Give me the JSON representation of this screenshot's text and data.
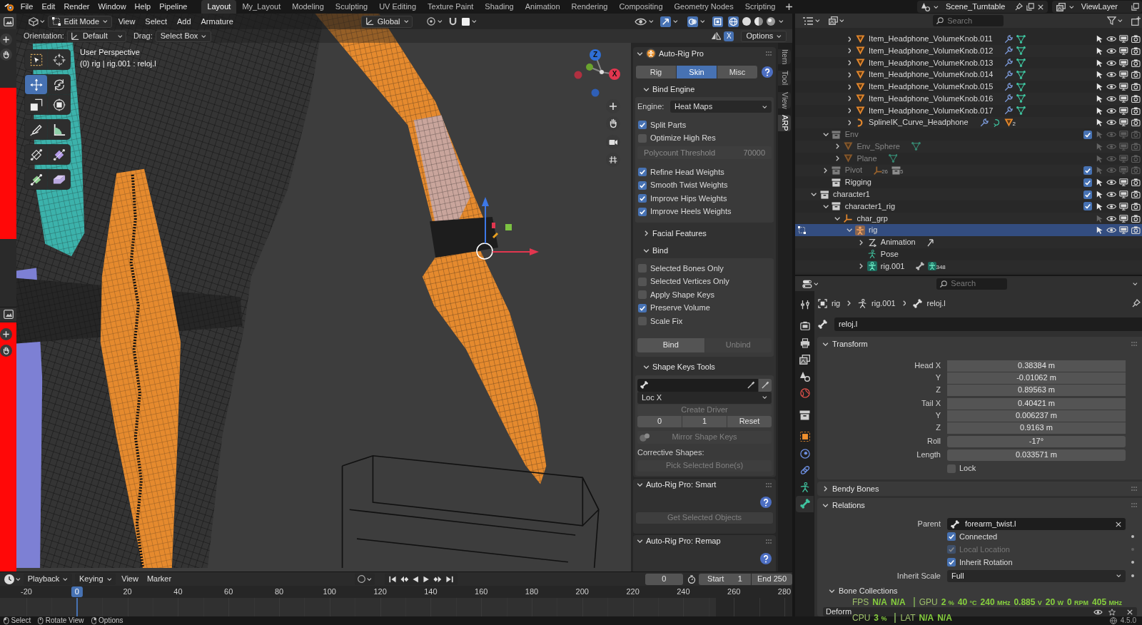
{
  "top_bar": {
    "menus": [
      "File",
      "Edit",
      "Render",
      "Window",
      "Help",
      "Pipeline"
    ],
    "workspaces": [
      {
        "label": "Layout",
        "selected": true
      },
      {
        "label": "My_Layout",
        "selected": false
      },
      {
        "label": "Modeling",
        "selected": false
      },
      {
        "label": "Sculpting",
        "selected": false
      },
      {
        "label": "UV Editing",
        "selected": false
      },
      {
        "label": "Texture Paint",
        "selected": false
      },
      {
        "label": "Shading",
        "selected": false
      },
      {
        "label": "Animation",
        "selected": false
      },
      {
        "label": "Rendering",
        "selected": false
      },
      {
        "label": "Compositing",
        "selected": false
      },
      {
        "label": "Geometry Nodes",
        "selected": false
      },
      {
        "label": "Scripting",
        "selected": false
      }
    ],
    "scene": "Scene_Turntable",
    "view_layer": "ViewLayer"
  },
  "viewport": {
    "header": {
      "mode": "Edit Mode",
      "menus": [
        "View",
        "Select",
        "Add",
        "Armature"
      ],
      "orientation": "Global"
    },
    "tool_settings": {
      "orientation_label": "Orientation:",
      "orientation": "Default",
      "drag_label": "Drag:",
      "drag": "Select Box",
      "mirror": {
        "label": "X",
        "on": true
      },
      "options": "Options"
    },
    "overlay_text": [
      "User Perspective",
      "(0) rig | rig.001 : reloj.l"
    ],
    "toolbar": [
      [
        {
          "kind": "select_box",
          "selected": false
        },
        {
          "kind": "cursor",
          "selected": false
        }
      ],
      [
        {
          "kind": "move",
          "selected": true
        },
        {
          "kind": "rotate",
          "selected": false
        },
        {
          "kind": "scale",
          "selected": false
        },
        {
          "kind": "transform",
          "selected": false
        }
      ],
      [
        {
          "kind": "annotate",
          "selected": false
        },
        {
          "kind": "measure",
          "selected": false
        }
      ],
      [
        {
          "kind": "roll",
          "selected": false
        },
        {
          "kind": "bone_size",
          "selected": false
        }
      ],
      [
        {
          "kind": "extrude",
          "selected": false
        },
        {
          "kind": "shear",
          "selected": false
        }
      ]
    ],
    "gizmo_axes": [
      {
        "label": "Z",
        "color": "#2f6fd6"
      },
      {
        "label": "X",
        "color": "#e2364f"
      }
    ],
    "sidebar_panels": [
      {
        "title": "Auto-Rig Pro",
        "expanded": true,
        "rows": [
          {
            "kind": "tabs",
            "items": [
              {
                "label": "Rig",
                "selected": false
              },
              {
                "label": "Skin",
                "selected": true
              },
              {
                "label": "Misc",
                "selected": false
              }
            ]
          },
          {
            "kind": "subpanel",
            "label": "Bind Engine",
            "expanded": true,
            "rows": [
              {
                "kind": "dropdown",
                "label": "Engine:",
                "value": "Heat Maps"
              },
              {
                "kind": "checkbox",
                "label": "Split Parts",
                "checked": true
              },
              {
                "kind": "checkbox",
                "label": "Optimize High Res",
                "checked": false
              },
              {
                "kind": "number",
                "label": "Polycount Threshold",
                "value": "70000",
                "disabled": true
              },
              {
                "kind": "checkbox",
                "label": "Refine Head Weights",
                "checked": true
              },
              {
                "kind": "checkbox",
                "label": "Smooth Twist Weights",
                "checked": true
              },
              {
                "kind": "checkbox",
                "label": "Improve Hips Weights",
                "checked": true
              },
              {
                "kind": "checkbox",
                "label": "Improve Heels Weights",
                "checked": true
              }
            ]
          },
          {
            "kind": "subpanel",
            "label": "Facial Features",
            "expanded": false
          },
          {
            "kind": "subpanel",
            "label": "Bind",
            "expanded": true,
            "rows": [
              {
                "kind": "checkbox",
                "label": "Selected Bones Only",
                "checked": false
              },
              {
                "kind": "checkbox",
                "label": "Selected Vertices Only",
                "checked": false
              },
              {
                "kind": "checkbox",
                "label": "Apply Shape Keys",
                "checked": false
              },
              {
                "kind": "checkbox",
                "label": "Preserve Volume",
                "checked": true
              },
              {
                "kind": "checkbox",
                "label": "Scale Fix",
                "checked": false
              },
              {
                "kind": "buttons",
                "items": [
                  {
                    "label": "Bind",
                    "disabled": false
                  },
                  {
                    "label": "Unbind",
                    "disabled": true
                  }
                ]
              }
            ]
          },
          {
            "kind": "subpanel",
            "label": "Shape Keys Tools",
            "expanded": true,
            "rows": [
              {
                "kind": "bone_field"
              },
              {
                "kind": "dropdown",
                "value": "Loc X"
              },
              {
                "kind": "buttons",
                "items": [
                  {
                    "label": "Create Driver",
                    "disabled": true
                  }
                ]
              },
              {
                "kind": "buttons",
                "items": [
                  {
                    "label": "0",
                    "disabled": false
                  },
                  {
                    "label": "1",
                    "disabled": false
                  },
                  {
                    "label": "Reset",
                    "disabled": false
                  }
                ]
              },
              {
                "kind": "icon_button",
                "label": "Mirror Shape Keys",
                "disabled": true
              },
              {
                "kind": "label",
                "label": "Corrective Shapes:"
              },
              {
                "kind": "buttons",
                "items": [
                  {
                    "label": "Pick Selected Bone(s)",
                    "disabled": true
                  }
                ]
              }
            ]
          }
        ]
      },
      {
        "title": "Auto-Rig Pro: Smart",
        "expanded": true,
        "rows": [
          {
            "kind": "help"
          },
          {
            "kind": "buttons",
            "items": [
              {
                "label": "Get Selected Objects",
                "disabled": true
              }
            ]
          }
        ]
      },
      {
        "title": "Auto-Rig Pro: Remap",
        "expanded": true,
        "rows": [
          {
            "kind": "help"
          }
        ]
      }
    ],
    "sidebar_tabs": [
      {
        "label": "Item",
        "selected": false
      },
      {
        "label": "Tool",
        "selected": false
      },
      {
        "label": "View",
        "selected": false
      },
      {
        "label": "ARP",
        "selected": true
      }
    ]
  },
  "timeline": {
    "menus": [
      {
        "label": "Playback",
        "kind": "dropdown"
      },
      {
        "label": "Keying",
        "kind": "dropdown"
      },
      {
        "label": "View",
        "kind": "menu"
      },
      {
        "label": "Marker",
        "kind": "menu"
      }
    ],
    "auto_keying": false,
    "current_frame": "0",
    "start_label": "Start",
    "start": "1",
    "end_label": "End",
    "end": "250",
    "ruler": [
      {
        "label": "-20",
        "current": false
      },
      {
        "label": "0",
        "current": true
      },
      {
        "label": "20",
        "current": false
      },
      {
        "label": "40",
        "current": false
      },
      {
        "label": "60",
        "current": false
      },
      {
        "label": "80",
        "current": false
      },
      {
        "label": "100",
        "current": false
      },
      {
        "label": "120",
        "current": false
      },
      {
        "label": "140",
        "current": false
      },
      {
        "label": "160",
        "current": false
      },
      {
        "label": "180",
        "current": false
      },
      {
        "label": "200",
        "current": false
      },
      {
        "label": "220",
        "current": false
      },
      {
        "label": "240",
        "current": false
      },
      {
        "label": "260",
        "current": false
      },
      {
        "label": "280",
        "current": false
      }
    ]
  },
  "outliner": {
    "search_placeholder": "Search",
    "tree": [
      {
        "children": [
          {
            "children": [
              {
                "children": [
                  {
                    "label": "Item_Headphone_VolumeKnob.011",
                    "kind": "mesh",
                    "expanded": false,
                    "selected": false,
                    "dimmed": false,
                    "selectable": true,
                    "extras": [
                      {
                        "kind": "modifier"
                      },
                      {
                        "kind": "mesh_data"
                      }
                    ]
                  },
                  {
                    "label": "Item_Headphone_VolumeKnob.012",
                    "kind": "mesh",
                    "expanded": false,
                    "selected": false,
                    "dimmed": false,
                    "selectable": true,
                    "extras": [
                      {
                        "kind": "modifier"
                      },
                      {
                        "kind": "mesh_data"
                      }
                    ]
                  },
                  {
                    "label": "Item_Headphone_VolumeKnob.013",
                    "kind": "mesh",
                    "expanded": false,
                    "selected": false,
                    "dimmed": false,
                    "selectable": true,
                    "extras": [
                      {
                        "kind": "modifier"
                      },
                      {
                        "kind": "mesh_data"
                      }
                    ]
                  },
                  {
                    "label": "Item_Headphone_VolumeKnob.014",
                    "kind": "mesh",
                    "expanded": false,
                    "selected": false,
                    "dimmed": false,
                    "selectable": true,
                    "extras": [
                      {
                        "kind": "modifier"
                      },
                      {
                        "kind": "mesh_data"
                      }
                    ]
                  },
                  {
                    "label": "Item_Headphone_VolumeKnob.015",
                    "kind": "mesh",
                    "expanded": false,
                    "selected": false,
                    "dimmed": false,
                    "selectable": true,
                    "extras": [
                      {
                        "kind": "modifier"
                      },
                      {
                        "kind": "mesh_data"
                      }
                    ]
                  },
                  {
                    "label": "Item_Headphone_VolumeKnob.016",
                    "kind": "mesh",
                    "expanded": false,
                    "selected": false,
                    "dimmed": false,
                    "selectable": true,
                    "extras": [
                      {
                        "kind": "modifier"
                      },
                      {
                        "kind": "mesh_data"
                      }
                    ]
                  },
                  {
                    "label": "Item_Headphone_VolumeKnob.017",
                    "kind": "mesh",
                    "expanded": false,
                    "selected": false,
                    "dimmed": false,
                    "selectable": true,
                    "extras": [
                      {
                        "kind": "modifier"
                      },
                      {
                        "kind": "mesh_data"
                      }
                    ]
                  },
                  {
                    "label": "SplineIK_Curve_Headphone",
                    "kind": "curve",
                    "expanded": false,
                    "selected": false,
                    "dimmed": false,
                    "selectable": true,
                    "extras": [
                      {
                        "kind": "modifier"
                      },
                      {
                        "kind": "curve_data"
                      },
                      {
                        "kind": "mesh",
                        "count": "2"
                      }
                    ]
                  }
                ]
              }
            ]
          },
          {
            "label": "Env",
            "kind": "collection",
            "expanded": true,
            "checked": true,
            "selected": false,
            "dimmed": true,
            "selectable": true,
            "children": [
              {
                "label": "Env_Sphere",
                "kind": "mesh",
                "expanded": false,
                "selected": false,
                "dimmed": true,
                "selectable": true,
                "extras": [
                  {
                    "kind": "mesh_data"
                  }
                ]
              },
              {
                "label": "Plane",
                "kind": "mesh",
                "expanded": false,
                "selected": false,
                "dimmed": true,
                "selectable": true,
                "extras": [
                  {
                    "kind": "mesh_data"
                  }
                ]
              }
            ]
          },
          {
            "label": "Pivot",
            "kind": "collection",
            "expanded": false,
            "checked": true,
            "selected": false,
            "dimmed": true,
            "selectable": true,
            "extras": [
              {
                "kind": "empty",
                "count": "26"
              },
              {
                "kind": "collection",
                "count": "5"
              }
            ]
          },
          {
            "label": "Rigging",
            "kind": "collection",
            "checked": true,
            "selected": false,
            "dimmed": false,
            "selectable": true
          }
        ]
      },
      {
        "label": "character1",
        "kind": "collection",
        "expanded": true,
        "checked": true,
        "selected": false,
        "dimmed": false,
        "selectable": true,
        "children": [
          {
            "label": "character1_rig",
            "kind": "collection",
            "expanded": true,
            "checked": true,
            "selected": false,
            "dimmed": false,
            "selectable": true,
            "children": [
              {
                "label": "char_grp",
                "kind": "empty",
                "expanded": true,
                "selected": false,
                "dimmed": false,
                "selectable": false,
                "children": [
                  {
                    "label": "rig",
                    "kind": "armature",
                    "expanded": true,
                    "selected": true,
                    "dimmed": false,
                    "selectable": true,
                    "children": [
                      {
                        "label": "Animation",
                        "kind": "action",
                        "expanded": false,
                        "selected": false,
                        "extras": [
                          {
                            "kind": "action"
                          }
                        ]
                      },
                      {
                        "label": "Pose",
                        "kind": "pose",
                        "selected": false
                      },
                      {
                        "label": "rig.001",
                        "kind": "armature_data",
                        "expanded": false,
                        "selected": false,
                        "extras": [
                          {
                            "kind": "bone_constraint"
                          },
                          {
                            "kind": "armature_data",
                            "count": "348"
                          }
                        ]
                      }
                    ]
                  }
                ]
              }
            ]
          }
        ]
      }
    ]
  },
  "properties": {
    "search_placeholder": "Search",
    "tabs": [
      {
        "kind": "tool",
        "selected": false
      },
      {
        "kind": "render",
        "selected": false
      },
      {
        "kind": "output",
        "selected": false
      },
      {
        "kind": "view_layer",
        "selected": false
      },
      {
        "kind": "scene",
        "selected": false
      },
      {
        "kind": "world",
        "selected": false
      },
      {
        "kind": "collection",
        "selected": false
      },
      {
        "kind": "object",
        "selected": false
      },
      {
        "kind": "physics",
        "selected": false
      },
      {
        "kind": "constraints",
        "selected": false
      },
      {
        "kind": "data",
        "selected": false
      },
      {
        "kind": "bone",
        "selected": true
      }
    ],
    "breadcrumb": [
      {
        "kind": "object",
        "label": "rig"
      },
      {
        "kind": "armature_data",
        "label": "rig.001"
      },
      {
        "kind": "bone",
        "label": "reloj.l"
      }
    ],
    "name": "reloj.l",
    "transform": {
      "title": "Transform",
      "expanded": true,
      "groups": [
        [
          {
            "label": "Head X",
            "value": "0.38384 m"
          },
          {
            "label": "Y",
            "value": "-0.01062 m"
          },
          {
            "label": "Z",
            "value": "0.89563 m"
          }
        ],
        [
          {
            "label": "Tail X",
            "value": "0.40421 m"
          },
          {
            "label": "Y",
            "value": "0.006237 m"
          },
          {
            "label": "Z",
            "value": "0.9163 m"
          }
        ],
        [
          {
            "label": "Roll",
            "value": "-17°"
          }
        ],
        [
          {
            "label": "Length",
            "value": "0.033571 m"
          }
        ]
      ],
      "lock": {
        "label": "Lock",
        "checked": false
      }
    },
    "bendy_bones": {
      "title": "Bendy Bones",
      "expanded": false
    },
    "relations": {
      "title": "Relations",
      "expanded": true,
      "parent_label": "Parent",
      "parent": "forearm_twist.l",
      "options": [
        {
          "label": "Connected",
          "checked": true,
          "disabled": false
        },
        {
          "label": "Local Location",
          "checked": true,
          "disabled": true
        },
        {
          "label": "Inherit Rotation",
          "checked": true,
          "disabled": false
        }
      ],
      "inherit_scale_label": "Inherit Scale",
      "inherit_scale": "Full",
      "bone_collections": {
        "title": "Bone Collections",
        "expanded": true,
        "items": [
          "Deform"
        ]
      }
    }
  },
  "perf_overlay": [
    [
      {
        "label": "FPS",
        "values": [
          {
            "value": "N/A"
          },
          {
            "value": "N/A"
          }
        ]
      },
      {
        "label": "GPU",
        "values": [
          {
            "value": "2",
            "unit": "%"
          },
          {
            "value": "40",
            "unit": "°C"
          },
          {
            "value": "240",
            "unit": "MHz"
          },
          {
            "value": "0.885",
            "unit": "V"
          },
          {
            "value": "20",
            "unit": "W"
          },
          {
            "value": "0",
            "unit": "RPM"
          },
          {
            "value": "405",
            "unit": "MHz"
          }
        ]
      }
    ],
    [
      {
        "label": "CPU",
        "values": [
          {
            "value": "3",
            "unit": "%"
          }
        ]
      },
      {
        "label": "LAT",
        "values": [
          {
            "value": "N/A"
          },
          {
            "value": "N/A"
          }
        ]
      }
    ]
  ],
  "status_bar": {
    "hints": [
      {
        "kind": "left",
        "label": "Select"
      },
      {
        "kind": "middle",
        "label": "Rotate View"
      },
      {
        "kind": "right",
        "label": "Options"
      }
    ],
    "version": "4.5.0"
  }
}
